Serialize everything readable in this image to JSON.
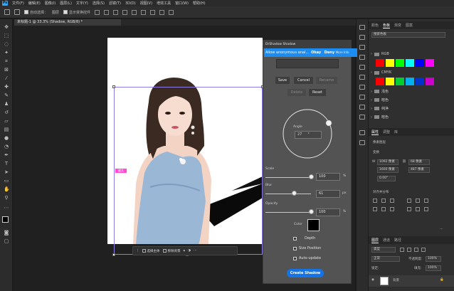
{
  "menubar": {
    "logo": "Ps",
    "items": [
      "文件(F)",
      "编辑(E)",
      "图像(I)",
      "图层(L)",
      "文字(Y)",
      "选择(S)",
      "滤镜(T)",
      "3D(D)",
      "视图(V)",
      "增效工具",
      "窗口(W)",
      "帮助(H)"
    ]
  },
  "optbar": {
    "auto_select_label": "自动选择：",
    "auto_select_value": "图层",
    "show_transform_label": "显示变换控件"
  },
  "document": {
    "tab_title": "未标题-1 @ 33.3% (Shadow, RGB/8) *",
    "magnifier_badge": "放大"
  },
  "taskbar": {
    "select_subject": "选择主体",
    "remove_background": "移除背景"
  },
  "plugin": {
    "title": "DrShadow Shadow",
    "banner": {
      "text": "Allow anonymous anal...",
      "okay": "Okay",
      "deny": "Deny",
      "more": "More Info"
    },
    "buttons": {
      "save": "Save",
      "cancel": "Cancel",
      "rename": "Rename",
      "delete": "Delete",
      "reset": "Reset"
    },
    "angle": {
      "label": "Angle",
      "value": "27",
      "unit": "°"
    },
    "scale": {
      "label": "Scale",
      "value": "100",
      "unit": "%",
      "level": 1.0
    },
    "blur": {
      "label": "Blur",
      "value": "61",
      "unit": "px",
      "level": 0.61
    },
    "opacity": {
      "label": "Opacity",
      "value": "100",
      "unit": "%",
      "level": 1.0
    },
    "color": {
      "label": "Color",
      "swatch": "#000000"
    },
    "checks": {
      "depth": "Depth",
      "size_position": "Size Position",
      "auto_update": "Auto-update"
    },
    "create": "Create Shadow"
  },
  "right": {
    "tabs_top": [
      "颜色",
      "色板",
      "渐变",
      "图案"
    ],
    "search_placeholder": "搜索色板",
    "groups": [
      "RGB",
      "CMYK",
      "浅色",
      "暗色",
      "纯净",
      "暗色"
    ],
    "rgb_colors": [
      "#ff0000",
      "#ffff00",
      "#00ff00",
      "#00ffff",
      "#0000ff",
      "#ff00ff"
    ],
    "cmyk_colors": [
      "#ff0000",
      "#ffff00",
      "#00cc33",
      "#00b0f0",
      "#0033cc",
      "#cc00cc"
    ],
    "tabs_mid": [
      "属性",
      "调整",
      "库"
    ],
    "prop_section": "像素图层",
    "transform_label": "变换",
    "w_value": "1092 像素",
    "h_value": "1600 像素",
    "x_value": "68 像素",
    "y_value": "487 像素",
    "angle_value": "0.00°",
    "align_label": "对齐并分布",
    "tabs_layers": [
      "图层",
      "通道",
      "路径"
    ],
    "kind_label": "类型",
    "blend_value": "正常",
    "opacity_label": "不透明度:",
    "opacity_value": "100%",
    "lock_label": "锁定:",
    "fill_label": "填充:",
    "fill_value": "100%",
    "layer_name": "背景"
  }
}
